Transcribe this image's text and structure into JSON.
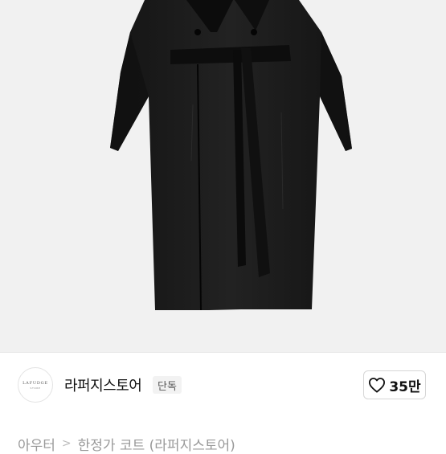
{
  "product": {
    "image_icon": "long-black-coat-photo"
  },
  "store": {
    "logo_text": "LAFUDGE",
    "logo_subtext": "STORE",
    "name": "라퍼지스토어",
    "badge": "단독"
  },
  "likes": {
    "icon": "heart-outline-icon",
    "count": "35만"
  },
  "breadcrumb": {
    "category": "아우터",
    "separator": ">",
    "title": "한정가 코트 (라퍼지스토어)"
  }
}
